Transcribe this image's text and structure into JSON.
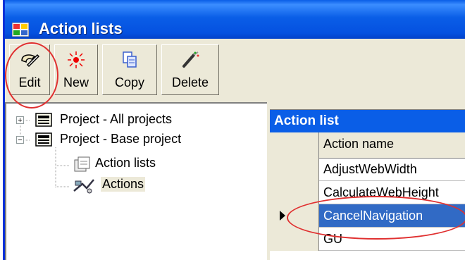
{
  "window": {
    "title": "Action lists"
  },
  "toolbar": {
    "buttons": [
      {
        "label": "Edit",
        "icon": "edit-icon"
      },
      {
        "label": "New",
        "icon": "new-icon"
      },
      {
        "label": "Copy",
        "icon": "copy-icon"
      },
      {
        "label": "Delete",
        "icon": "delete-icon"
      }
    ]
  },
  "tree": {
    "items": [
      {
        "label": "Project - All projects",
        "expander": "+"
      },
      {
        "label": "Project - Base project",
        "expander": "−"
      },
      {
        "label": "Action lists"
      },
      {
        "label": "Actions"
      }
    ]
  },
  "grid": {
    "caption": "Action list",
    "column": "Action name",
    "rows": [
      {
        "name": "AdjustWebWidth"
      },
      {
        "name": "CalculateWebHeight"
      },
      {
        "name": "CancelNavigation",
        "selected": true
      },
      {
        "name": "GU"
      }
    ]
  },
  "colors": {
    "title_blue": "#0a5ee7",
    "selection": "#316ac5",
    "annotation": "#e03030"
  }
}
